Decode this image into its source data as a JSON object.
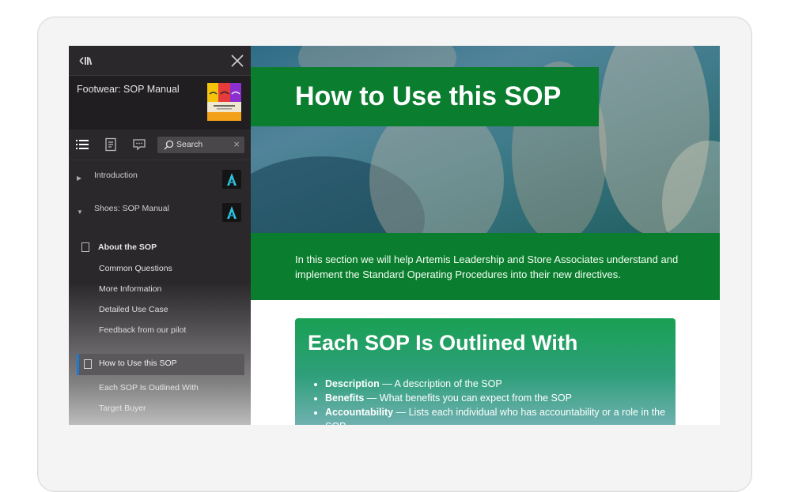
{
  "sidebar": {
    "title": "Footwear: SOP Manual",
    "search_label": "Search",
    "chapters": [
      {
        "label": "Introduction"
      },
      {
        "label": "Shoes: SOP Manual"
      }
    ],
    "section_about": {
      "label": "About the SOP",
      "items": [
        "Common Questions",
        "More Information",
        "Detailed Use Case",
        "Feedback from our pilot"
      ]
    },
    "section_active": {
      "label": "How to Use this SOP",
      "items": [
        "Each SOP Is Outlined With",
        "Target Buyer"
      ]
    }
  },
  "main": {
    "hero_title": "How to Use this SOP",
    "intro_text": "In this section we will help Artemis Leadership and Store Associates understand and implement the Standard Operating Procedures into their new directives.",
    "card": {
      "title": "Each SOP Is Outlined With",
      "items": [
        {
          "term": "Description",
          "text": " — A description of the SOP"
        },
        {
          "term": "Benefits",
          "text": " — What benefits you can expect from the SOP"
        },
        {
          "term": "Accountability",
          "text": " — Lists each individual who has accountability or a role in the SOP"
        }
      ]
    }
  },
  "colors": {
    "accent_green": "#0b7d2f",
    "sidebar_bg": "#2b282b",
    "active_bar": "#1a7bd4"
  }
}
